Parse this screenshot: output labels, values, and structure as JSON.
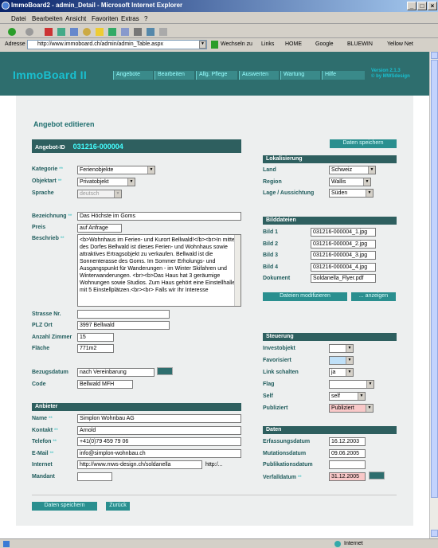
{
  "window": {
    "title": "ImmoBoard2 - admin_Detail - Microsoft Internet Explorer"
  },
  "menu": [
    "Datei",
    "Bearbeiten",
    "Ansicht",
    "Favoriten",
    "Extras",
    "?"
  ],
  "address": {
    "label": "Adresse",
    "url": "http://www.immoboard.ch/admin/admin_Table.aspx",
    "go": "Wechseln zu",
    "links": "Links",
    "link_items": [
      "HOME",
      "Google",
      "BLUEWIN",
      "Yellow Net"
    ]
  },
  "app": {
    "logo": "ImmoBoard II",
    "version": "Version 2.1.3",
    "copyright": "© by MWSdesign"
  },
  "nav": [
    "Angebote",
    "Bearbeiten",
    "Allg. Pflege",
    "Auswerten",
    "Wartung",
    "Hilfe"
  ],
  "page": {
    "title": "Angebot editieren",
    "save": "Daten speichern",
    "back": "Zurück"
  },
  "angebot": {
    "id_label": "Angebot-ID",
    "id_value": "031216-000004",
    "kategorie_label": "Kategorie",
    "kategorie": "Ferienobjekte",
    "objektart_label": "Objektart",
    "objektart": "Privatobjekt",
    "sprache_label": "Sprache",
    "sprache": "deutsch",
    "bezeichnung_label": "Bezeichnung",
    "bezeichnung": "Das Höchste im Goms",
    "preis_label": "Preis",
    "preis": "auf Anfrage",
    "beschrieb_label": "Beschrieb",
    "beschrieb": "<b>Wohnhaus im Ferien- und Kurort Bellwald!</b><br>In mitten des Dorfes Bellwald ist dieses Ferien- und Wohnhaus sowie attraktives Ertragsobjekt zu verkaufen. Bellwald ist die Sonnenterasse des Goms. Im Sommer Erholungs- und Ausgangspunkt für Wanderungen - im Winter Skifahren und Winterwanderungen. <br><b>Das Haus hat 3 geräumige Wohnungen sowie Studios. Zum Haus gehört eine Einstellhalle mit 5 Einstellplätzen.<br><br> Falls wir Ihr Interesse",
    "strasse_label": "Strasse Nr.",
    "strasse": "",
    "plz_label": "PLZ Ort",
    "plz": "3997 Bellwald",
    "zimmer_label": "Anzahl Zimmer",
    "zimmer": "15",
    "flaeche_label": "Fläche",
    "flaeche": "771m2",
    "bezug_label": "Bezugsdatum",
    "bezug": "nach Vereinbarung",
    "code_label": "Code",
    "code": "Bellwald MFH"
  },
  "anbieter": {
    "header": "Anbieter",
    "name_label": "Name",
    "name": "Simplon Wohnbau AG",
    "kontakt_label": "Kontakt",
    "kontakt": "Arnold",
    "telefon_label": "Telefon",
    "telefon": "+41(0)79 459 79 06",
    "email_label": "E-Mail",
    "email": "info@simplon-wohnbau.ch",
    "internet_label": "Internet",
    "internet": "http://www.mws-design.ch/soldanella",
    "internet_hint": "http:/...",
    "mandant_label": "Mandant",
    "mandant": ""
  },
  "lokalisierung": {
    "header": "Lokalisierung",
    "land_label": "Land",
    "land": "Schweiz",
    "region_label": "Region",
    "region": "Wallis",
    "lage_label": "Lage / Aussichtung",
    "lage": "Süden"
  },
  "bilder": {
    "header": "Bilddateien",
    "b1_label": "Bild 1",
    "b1": "031216-000004_1.jpg",
    "b2_label": "Bild 2",
    "b2": "031216-000004_2.jpg",
    "b3_label": "Bild 3",
    "b3": "031216-000004_3.jpg",
    "b4_label": "Bild 4",
    "b4": "031216-000004_4.jpg",
    "dok_label": "Dokument",
    "dok": "Soldanella_Flyer.pdf",
    "modify": "Dateien modifizieren",
    "show": "... anzeigen"
  },
  "steuerung": {
    "header": "Steuerung",
    "invest_label": "Investobjekt",
    "invest": "",
    "fav_label": "Favorisiert",
    "fav": "",
    "link_label": "Link schalten",
    "link": "ja",
    "flag_label": "Flag",
    "flag": "",
    "self_label": "Self",
    "self": "self",
    "pub_label": "Publiziert",
    "pub": "Publiziert"
  },
  "daten": {
    "header": "Daten",
    "erf_label": "Erfassungsdatum",
    "erf": "16.12.2003",
    "mut_label": "Mutationsdatum",
    "mut": "09.06.2005",
    "publ_label": "Publikationsdatum",
    "publ": "",
    "verf_label": "Verfalldatum",
    "verf": "31.12.2005"
  },
  "status": {
    "zone": "Internet"
  },
  "colors": {
    "header": "#2e6e6e",
    "accent": "#19c0d0",
    "button": "#2a8f8f",
    "label": "#1f5c5c",
    "highlight": "#f8c8c8"
  }
}
